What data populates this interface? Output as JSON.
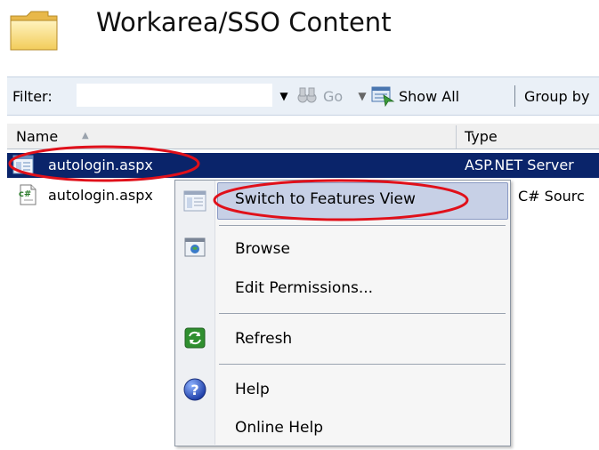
{
  "header": {
    "title": "Workarea/SSO Content",
    "icon": "folder-icon"
  },
  "toolbar": {
    "filter_label": "Filter:",
    "filter_value": "",
    "go_label": "Go",
    "show_all_label": "Show All",
    "group_by_label": "Group by"
  },
  "list": {
    "columns": [
      "Name",
      "Type"
    ],
    "sort_column": "Name",
    "rows": [
      {
        "name": "autologin.aspx",
        "type": "ASP.NET Server",
        "icon": "aspx-file-icon",
        "selected": true
      },
      {
        "name": "autologin.aspx",
        "type": "C# Sourc",
        "icon": "csharp-file-icon",
        "selected": false
      }
    ]
  },
  "context_menu": {
    "items": [
      {
        "label": "Switch to Features View",
        "icon": "features-view-icon",
        "highlighted": true
      },
      {
        "label": "Browse",
        "icon": "browse-icon"
      },
      {
        "label": "Edit Permissions...",
        "icon": ""
      },
      {
        "label": "Refresh",
        "icon": "refresh-icon"
      },
      {
        "label": "Help",
        "icon": "help-icon"
      },
      {
        "label": "Online Help",
        "icon": ""
      }
    ]
  },
  "colors": {
    "selection": "#0a246a",
    "annotation": "#e0101a",
    "toolbar_bg": "#eaf0f7",
    "menu_highlight": "#c7d0e6"
  }
}
